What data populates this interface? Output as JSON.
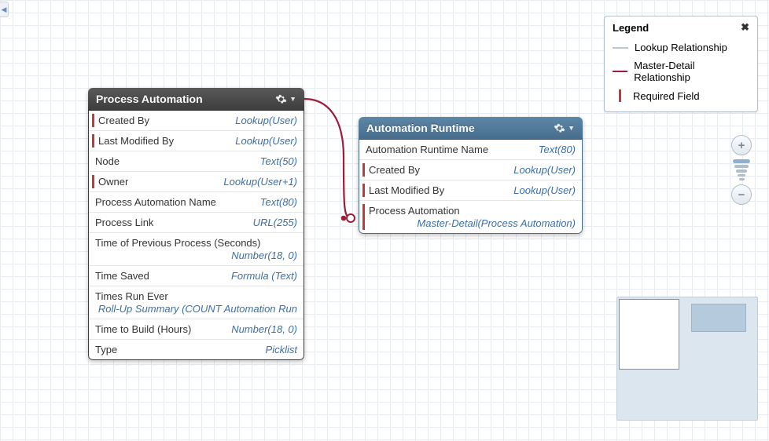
{
  "collapse_glyph": "◀",
  "legend": {
    "title": "Legend",
    "close": "✖",
    "items": [
      {
        "label": "Lookup Relationship",
        "swatch": "line"
      },
      {
        "label": "Master-Detail Relationship",
        "swatch": "line-red"
      },
      {
        "label": "Required Field",
        "swatch": "bar"
      }
    ]
  },
  "zoom": {
    "plus": "+",
    "minus": "−"
  },
  "entities": {
    "process_automation": {
      "title": "Process Automation",
      "fields": [
        {
          "label": "Created By",
          "type": "Lookup(User)",
          "required": true
        },
        {
          "label": "Last Modified By",
          "type": "Lookup(User)",
          "required": true
        },
        {
          "label": "Node",
          "type": "Text(50)",
          "required": false
        },
        {
          "label": "Owner",
          "type": "Lookup(User+1)",
          "required": true
        },
        {
          "label": "Process Automation Name",
          "type": "Text(80)",
          "required": false
        },
        {
          "label": "Process Link",
          "type": "URL(255)",
          "required": false
        },
        {
          "label": "Time of Previous Process (Seconds)",
          "type": "Number(18, 0)",
          "required": false,
          "stack": true
        },
        {
          "label": "Time Saved",
          "type": "Formula (Text)",
          "required": false
        },
        {
          "label": "Times Run Ever",
          "type": "Roll-Up Summary (COUNT Automation Run",
          "required": false,
          "stack": true
        },
        {
          "label": "Time to Build (Hours)",
          "type": "Number(18, 0)",
          "required": false
        },
        {
          "label": "Type",
          "type": "Picklist",
          "required": false
        }
      ]
    },
    "automation_runtime": {
      "title": "Automation Runtime",
      "fields": [
        {
          "label": "Automation Runtime Name",
          "type": "Text(80)",
          "required": false
        },
        {
          "label": "Created By",
          "type": "Lookup(User)",
          "required": true
        },
        {
          "label": "Last Modified By",
          "type": "Lookup(User)",
          "required": true
        },
        {
          "label": "Process Automation",
          "type": "Master-Detail(Process Automation)",
          "required": true,
          "stack": true
        }
      ]
    }
  }
}
